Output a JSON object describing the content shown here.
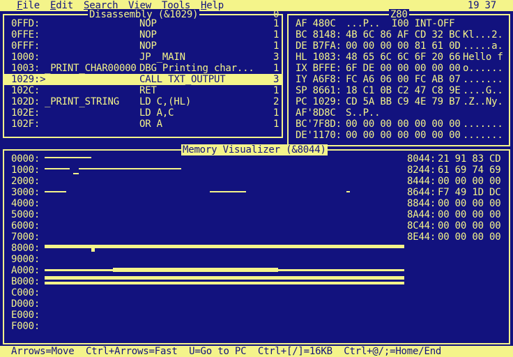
{
  "menubar": {
    "items": [
      {
        "label": "File",
        "hot": "F",
        "rest": "ile"
      },
      {
        "label": "Edit",
        "hot": "E",
        "rest": "dit"
      },
      {
        "label": "Search",
        "hot": "S",
        "rest": "earch"
      },
      {
        "label": "View",
        "hot": "V",
        "rest": "iew"
      },
      {
        "label": "Tools",
        "hot": "T",
        "rest": "ools"
      },
      {
        "label": "Help",
        "hot": "H",
        "rest": "elp"
      }
    ],
    "clock": "19 37"
  },
  "disassembly": {
    "title": "Disassembly (&1029)",
    "scroll_top": "0",
    "rows": [
      {
        "addr": "0FFD:",
        "label": "",
        "instr": "NOP",
        "count": "1"
      },
      {
        "addr": "0FFE:",
        "label": "",
        "instr": "NOP",
        "count": "1"
      },
      {
        "addr": "0FFF:",
        "label": "",
        "instr": "NOP",
        "count": "1"
      },
      {
        "addr": "1000:",
        "label": "",
        "instr": "JP _MAIN",
        "count": "3"
      },
      {
        "addr": "1003:",
        "label": "_PRINT_CHAR00000",
        "instr": "DBG Printing char...",
        "count": "1"
      },
      {
        "addr": "1029:>",
        "label": "",
        "instr": "CALL TXT_OUTPUT",
        "count": "3"
      },
      {
        "addr": "102C:",
        "label": "",
        "instr": "RET",
        "count": "1"
      },
      {
        "addr": "102D:",
        "label": "_PRINT_STRING",
        "instr": "LD C,(HL)",
        "count": "2"
      },
      {
        "addr": "102E:",
        "label": "",
        "instr": "LD A,C",
        "count": "1"
      },
      {
        "addr": "102F:",
        "label": "",
        "instr": "OR A",
        "count": "1"
      }
    ],
    "highlight_index": 5
  },
  "z80": {
    "title": "Z80",
    "rows": [
      {
        "reg": "AF 480C",
        "bytes": "",
        "ascii": "...P..  I00 INT-OFF"
      },
      {
        "reg": "BC 8148:",
        "bytes": "4B 6C 86 AF CD 32 BC",
        "ascii": "Kl...2."
      },
      {
        "reg": "DE B7FA:",
        "bytes": "00 00 00 00 81 61 0D",
        "ascii": ".....a."
      },
      {
        "reg": "HL 1083:",
        "bytes": "48 65 6C 6C 6F 20 66",
        "ascii": "Hello f"
      },
      {
        "reg": "IX BFFE:",
        "bytes": "6F DE 00 00 00 00 00",
        "ascii": "o......"
      },
      {
        "reg": "IY A6F8:",
        "bytes": "FC A6 06 00 FC AB 07",
        "ascii": "......."
      },
      {
        "reg": "SP 8661:",
        "bytes": "18 C1 0B C2 47 C8 9E",
        "ascii": "....G.."
      },
      {
        "reg": "PC 1029:",
        "bytes": "CD 5A BB C9 4E 79 B7",
        "ascii": ".Z..Ny."
      },
      {
        "reg": "AF'8D8C",
        "bytes": "",
        "ascii": "S..P.."
      },
      {
        "reg": "BC'7F8D:",
        "bytes": "00 00 00 00 00 00 00",
        "ascii": "......."
      },
      {
        "reg": "DE'1170:",
        "bytes": "00 00 00 00 00 00 00",
        "ascii": "......."
      }
    ]
  },
  "memory": {
    "title": "Memory Visualizer (&8044)",
    "banks": [
      "0000:",
      "1000:",
      "2000:",
      "3000:",
      "4000:",
      "5000:",
      "6000:",
      "7000:",
      "8000:",
      "9000:",
      "A000:",
      "B000:",
      "C000:",
      "D000:",
      "E000:",
      "F000:"
    ],
    "dump": [
      {
        "addr": "8044:",
        "bytes": "21 91 83 CD"
      },
      {
        "addr": "8244:",
        "bytes": "61 69 74 69"
      },
      {
        "addr": "8444:",
        "bytes": "00 00 00 00"
      },
      {
        "addr": "8644:",
        "bytes": "F7 49 1D DC"
      },
      {
        "addr": "8844:",
        "bytes": "00 00 00 00"
      },
      {
        "addr": "8A44:",
        "bytes": "00 00 00 00"
      },
      {
        "addr": "8C44:",
        "bytes": "00 00 00 00"
      },
      {
        "addr": "8E44:",
        "bytes": "00 00 00 00"
      }
    ]
  },
  "statusbar": {
    "text": "Arrows=Move  Ctrl+Arrows=Fast  U=Go to PC  Ctrl+[/]=16KB  Ctrl+@/;=Home/End"
  },
  "colors": {
    "foreground": "#f4f48a",
    "background": "#12127e"
  }
}
